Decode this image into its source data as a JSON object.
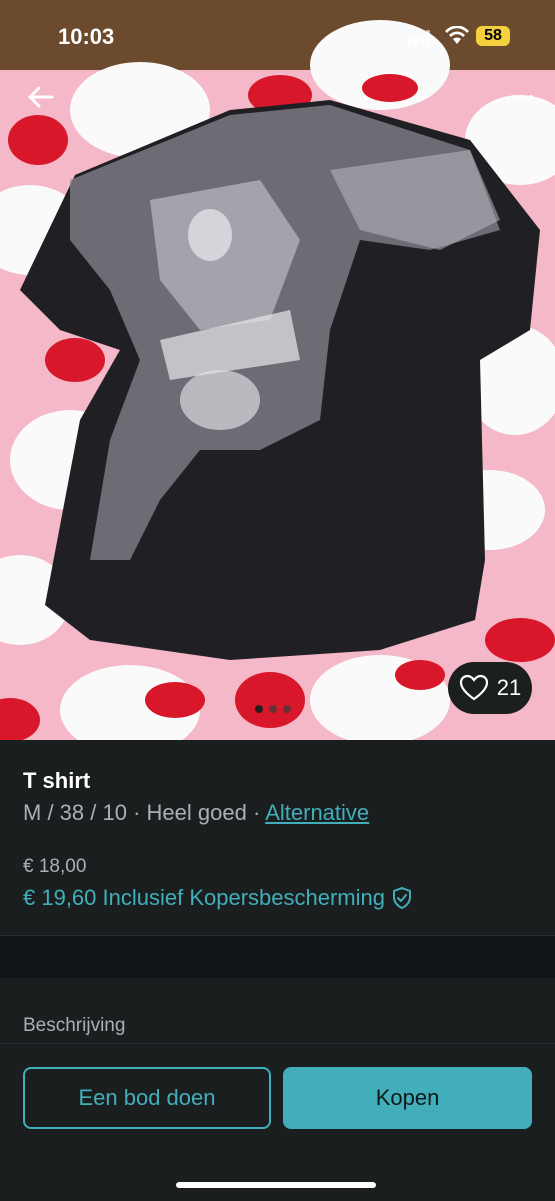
{
  "status_bar": {
    "time": "10:03",
    "battery": "58"
  },
  "photo": {
    "description_icon_back": "arrow-left-icon",
    "description_icon_more": "more-dots-icon",
    "favorites_count": "21",
    "carousel_pages": 3,
    "carousel_active": 1
  },
  "listing": {
    "title": "T shirt",
    "size": "M / 38 / 10",
    "condition": "Heel goed",
    "separator": "·",
    "brand": "Alternative",
    "price": "€ 18,00",
    "price_total": "€ 19,60 Inclusief Kopersbescherming"
  },
  "description_label": "Beschrijving",
  "actions": {
    "offer_label": "Een bod doen",
    "buy_label": "Kopen"
  },
  "colors": {
    "accent": "#41aeb9",
    "background": "#1a1e1f"
  }
}
